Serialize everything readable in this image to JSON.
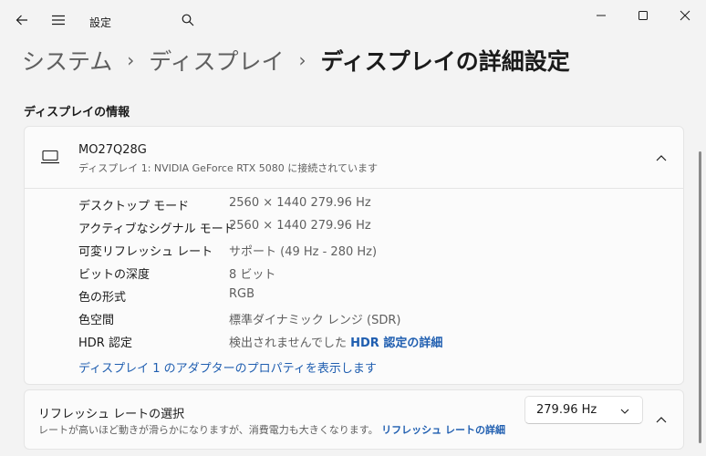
{
  "window": {
    "title": "設定"
  },
  "breadcrumb": {
    "items": [
      "システム",
      "ディスプレイ",
      "ディスプレイの詳細設定"
    ]
  },
  "section": {
    "title": "ディスプレイの情報"
  },
  "display": {
    "name": "MO27Q28G",
    "description": "ディスプレイ 1: NVIDIA GeForce RTX 5080 に接続されています",
    "properties": [
      {
        "label": "デスクトップ モード",
        "value": "2560 × 1440 279.96 Hz"
      },
      {
        "label": "アクティブなシグナル モード",
        "value": "2560 × 1440 279.96 Hz"
      },
      {
        "label": "可変リフレッシュ レート",
        "value": "サポート (49 Hz - 280 Hz)"
      },
      {
        "label": "ビットの深度",
        "value": "8 ビット"
      },
      {
        "label": "色の形式",
        "value": "RGB"
      },
      {
        "label": "色空間",
        "value": "標準ダイナミック レンジ (SDR)"
      },
      {
        "label": "HDR 認定",
        "value": "検出されませんでした",
        "link": "HDR 認定の詳細"
      }
    ],
    "adapter_link": "ディスプレイ 1 のアダプターのプロパティを表示します"
  },
  "refresh": {
    "title": "リフレッシュ レートの選択",
    "description": "レートが高いほど動きが滑らかになりますが、消費電力も大きくなります。",
    "link": "リフレッシュ レートの詳細",
    "selected": "279.96 Hz"
  },
  "colors": {
    "accent": "#1f5eb0",
    "background": "#f3f3f3",
    "card": "#fbfbfb"
  }
}
